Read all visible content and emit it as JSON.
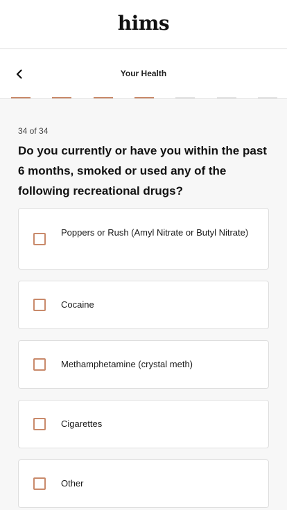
{
  "header": {
    "logo": "hims"
  },
  "nav": {
    "back_icon": "chevron-left-icon",
    "title": "Your Health"
  },
  "progress": {
    "completed_segments": 4,
    "total_segments": 7,
    "accent_color": "#c98a6b",
    "inactive_color": "#e4e4e4"
  },
  "question": {
    "counter": "34 of 34",
    "text": "Do you currently or have you within the past 6 months, smoked or used any of the following recreational drugs?"
  },
  "options": [
    {
      "label": "Poppers or Rush (Amyl Nitrate or Butyl Nitrate)",
      "checked": false
    },
    {
      "label": "Cocaine",
      "checked": false
    },
    {
      "label": "Methamphetamine (crystal meth)",
      "checked": false
    },
    {
      "label": "Cigarettes",
      "checked": false
    },
    {
      "label": "Other",
      "checked": false
    }
  ]
}
